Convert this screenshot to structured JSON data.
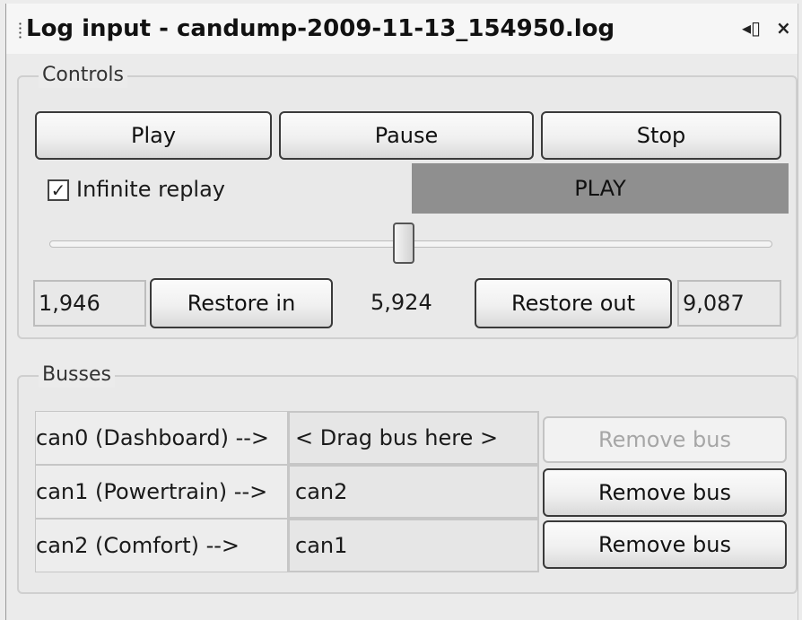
{
  "window": {
    "title": "Log input - candump-2009-11-13_154950.log",
    "float_icon": "◂▯",
    "close_icon": "×"
  },
  "controls": {
    "group_label": "Controls",
    "play_label": "Play",
    "pause_label": "Pause",
    "stop_label": "Stop",
    "infinite_replay_label": "Infinite replay",
    "infinite_replay_checked": true,
    "checkmark": "✓",
    "status_text": "PLAY",
    "slider_position_fraction": 0.49,
    "in_value": "1,946",
    "restore_in_label": "Restore in",
    "current_value": "5,924",
    "restore_out_label": "Restore out",
    "out_value": "9,087"
  },
  "busses": {
    "group_label": "Busses",
    "rows": [
      {
        "source": "can0 (Dashboard) -->",
        "target": "< Drag bus here >",
        "remove_label": "Remove bus",
        "remove_enabled": false
      },
      {
        "source": "can1 (Powertrain) -->",
        "target": "can2",
        "remove_label": "Remove bus",
        "remove_enabled": true
      },
      {
        "source": "can2 (Comfort) -->",
        "target": "can1",
        "remove_label": "Remove bus",
        "remove_enabled": true
      }
    ]
  }
}
